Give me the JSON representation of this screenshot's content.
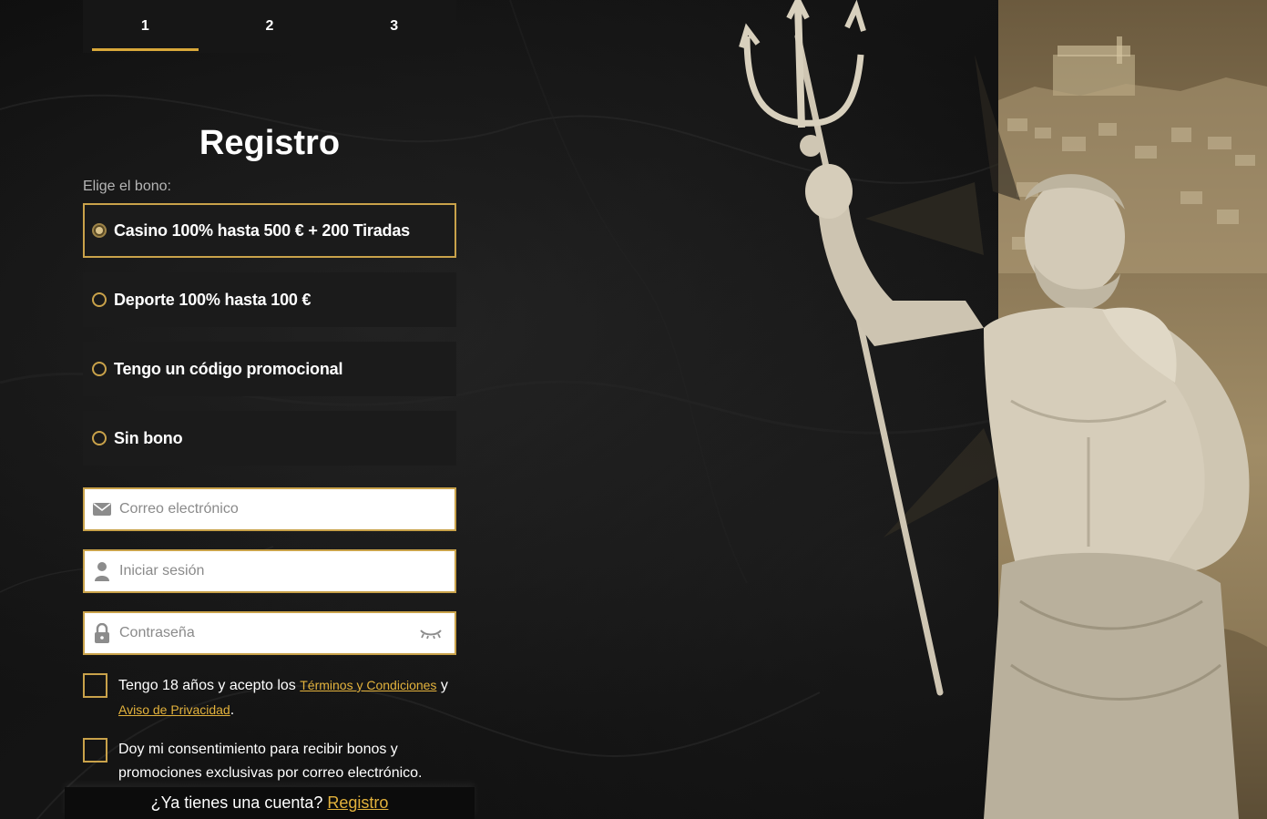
{
  "steps": [
    {
      "label": "1",
      "active": true
    },
    {
      "label": "2",
      "active": false
    },
    {
      "label": "3",
      "active": false
    }
  ],
  "title": "Registro",
  "bonus": {
    "label": "Elige el bono:",
    "options": [
      {
        "label": "Casino 100% hasta 500 € + 200 Tiradas",
        "selected": true
      },
      {
        "label": "Deporte 100% hasta 100 €",
        "selected": false
      },
      {
        "label": "Tengo un código promocional",
        "selected": false
      },
      {
        "label": "Sin bono",
        "selected": false
      }
    ]
  },
  "fields": {
    "email": {
      "placeholder": "Correo electrónico",
      "icon": "envelope-icon"
    },
    "login": {
      "placeholder": "Iniciar sesión",
      "icon": "user-icon"
    },
    "password": {
      "placeholder": "Contraseña",
      "icon": "lock-icon",
      "toggle_icon": "eye-closed-icon"
    }
  },
  "consents": {
    "age": {
      "text_before": "Tengo 18 años y acepto los ",
      "terms_link": "Términos y Condiciones",
      "text_mid": " y",
      "privacy_link": "Aviso de Privacidad",
      "text_after": "."
    },
    "marketing": {
      "text": "Doy mi consentimiento para recibir bonos y promociones exclusivas por correo electrónico."
    }
  },
  "footer": {
    "question": "¿Ya tienes una cuenta?",
    "link": "Registro"
  },
  "colors": {
    "accent": "#c9a24a",
    "link": "#e3b23c",
    "background": "#0b0b0b",
    "option_bg": "#1b1b1b"
  }
}
